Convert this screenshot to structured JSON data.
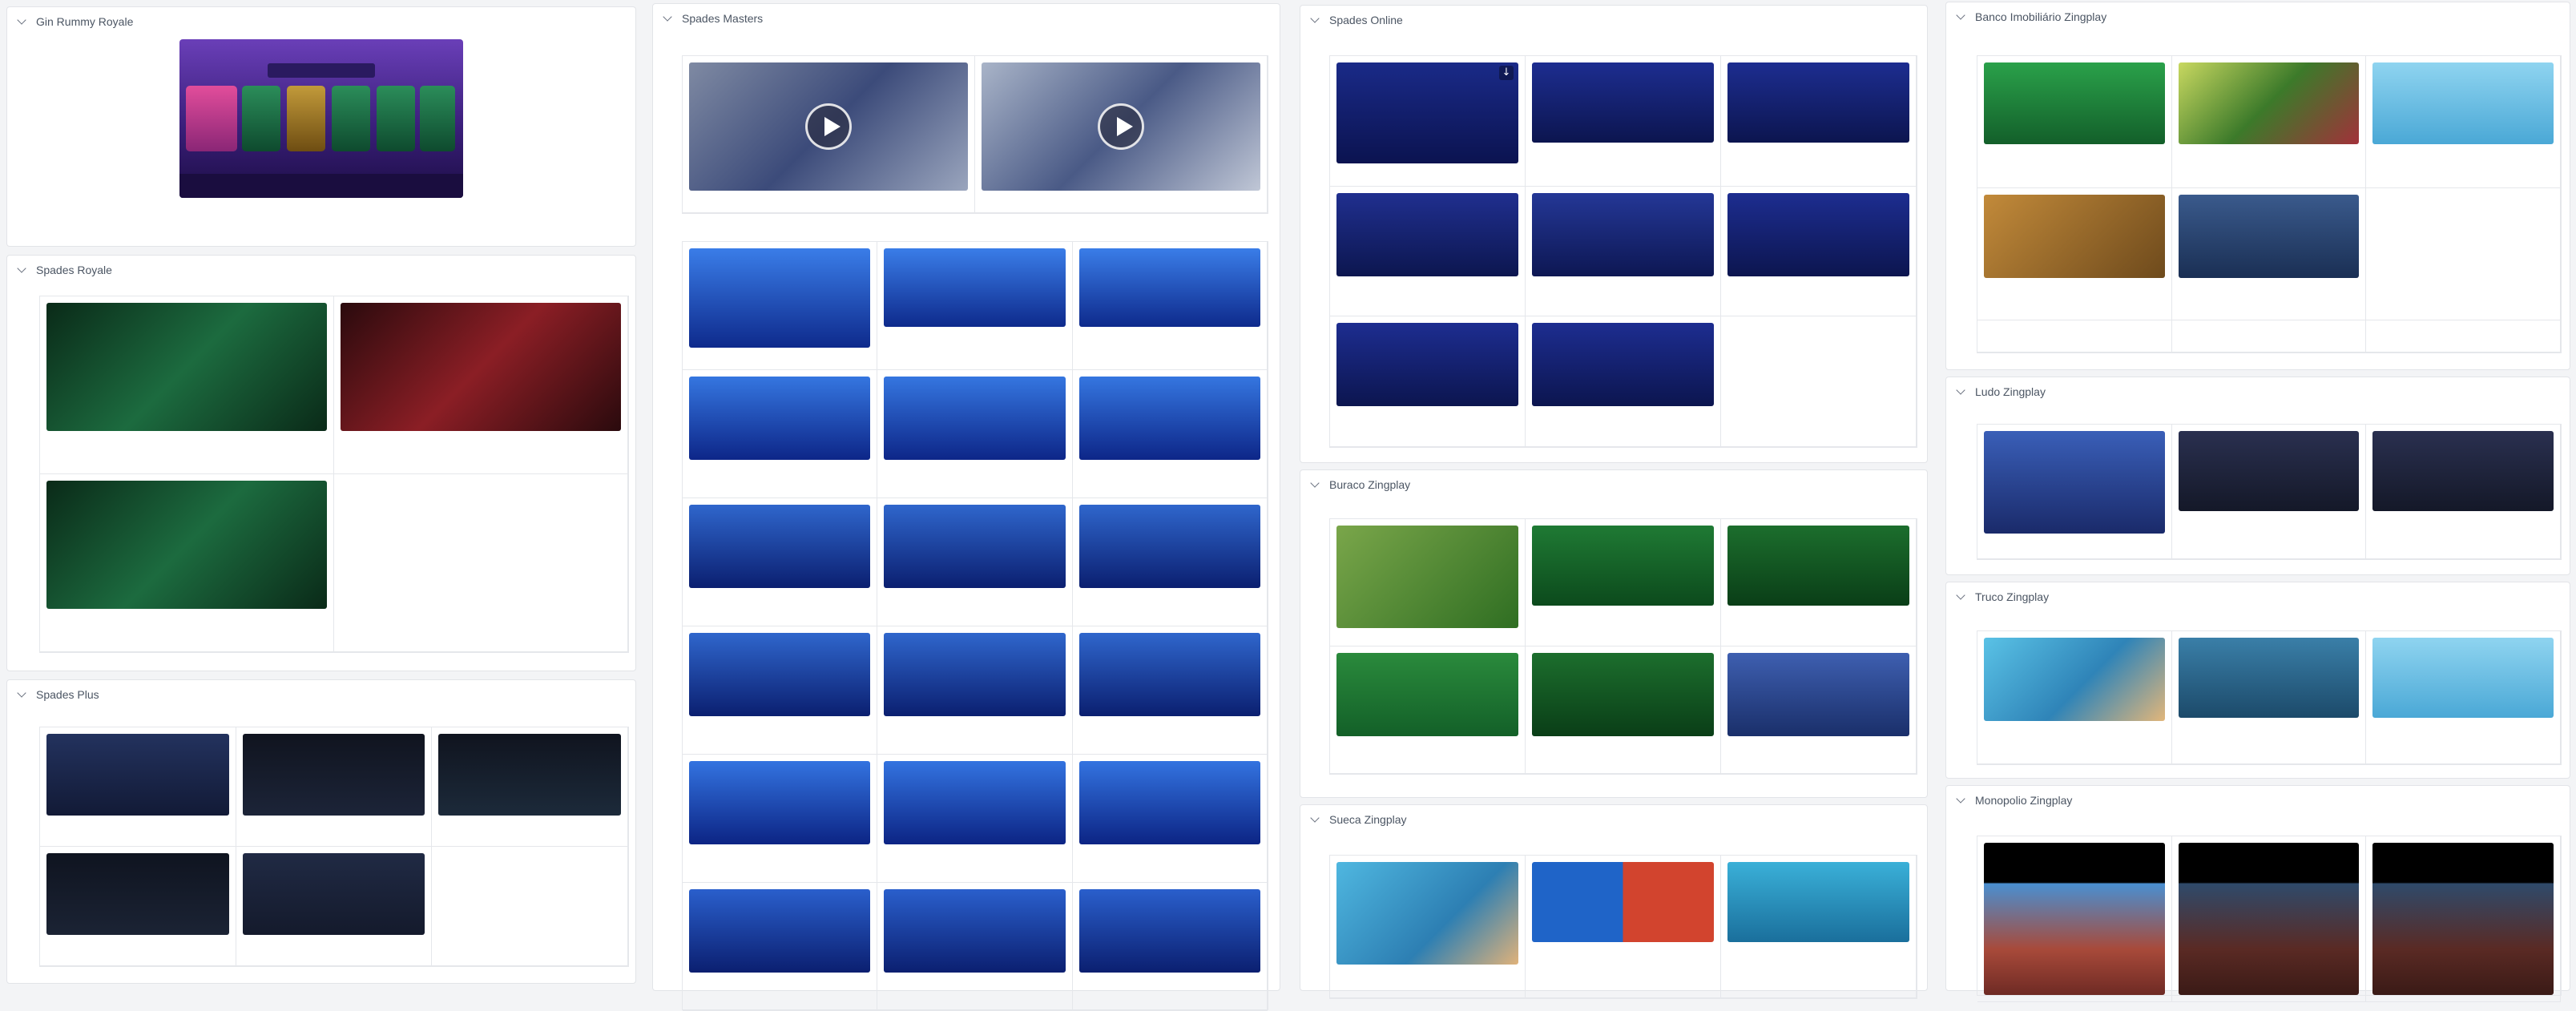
{
  "panels": {
    "gin_rummy_royale": {
      "title": "Gin Rummy Royale"
    },
    "spades_royale": {
      "title": "Spades Royale"
    },
    "spades_plus": {
      "title": "Spades Plus"
    },
    "spades_masters": {
      "title": "Spades Masters"
    },
    "spades_online": {
      "title": "Spades Online"
    },
    "buraco_zingplay": {
      "title": "Buraco Zingplay"
    },
    "sueca_zingplay": {
      "title": "Sueca Zingplay"
    },
    "banco_imobiliario_zingplay": {
      "title": "Banco Imobiliário Zingplay"
    },
    "ludo_zingplay": {
      "title": "Ludo Zingplay"
    },
    "truco_zingplay": {
      "title": "Truco Zingplay"
    },
    "monopolio_zingplay": {
      "title": "Monopolio Zingplay"
    }
  },
  "icons": {
    "collapse": "chevron-down-icon",
    "play": "play-icon",
    "download": "download-icon"
  },
  "colors": {
    "panel_bg": "#ffffff",
    "page_bg": "#f3f4f6",
    "border": "#e5e7eb",
    "casino_purple": "#4b2a86",
    "casino_green": "#0f5a3a",
    "casino_red": "#7a1820",
    "spades_blue": "#1d4fd0",
    "dark_navy": "#151c3a",
    "felt_green": "#0e6b2f"
  }
}
